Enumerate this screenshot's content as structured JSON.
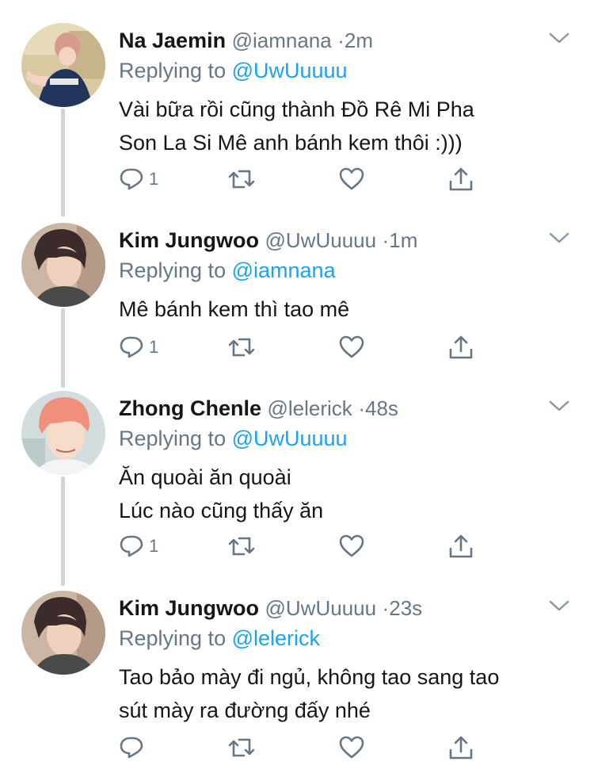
{
  "tweets": [
    {
      "name": "Na Jaemin",
      "handle": "@iamnana",
      "separator": "·",
      "time": "2m",
      "replying_prefix": "Replying to",
      "replying_to": "@UwUuuuu",
      "text": "Vài bữa rồi cũng thành Đồ Rê Mi Pha\nSon La Si Mê anh bánh kem thôi :)))",
      "reply_count": "1"
    },
    {
      "name": "Kim Jungwoo",
      "handle": "@UwUuuuu",
      "separator": "·",
      "time": "1m",
      "replying_prefix": "Replying to",
      "replying_to": "@iamnana",
      "text": "Mê bánh kem thì tao mê",
      "reply_count": "1"
    },
    {
      "name": "Zhong Chenle",
      "handle": "@lelerick",
      "separator": "·",
      "time": "48s",
      "replying_prefix": "Replying to",
      "replying_to": "@UwUuuuu",
      "text": "Ăn quoài ăn quoài\nLúc nào cũng thấy ăn",
      "reply_count": "1"
    },
    {
      "name": "Kim Jungwoo",
      "handle": "@UwUuuuu",
      "separator": "·",
      "time": "23s",
      "replying_prefix": "Replying to",
      "replying_to": "@lelerick",
      "text": "Tao bảo mày đi ngủ, không tao sang tao\nsút mày ra đường đấy nhé",
      "reply_count": ""
    }
  ],
  "icons": {
    "reply": "reply-icon",
    "retweet": "retweet-icon",
    "like": "heart-icon",
    "share": "share-icon",
    "more": "chevron-down-icon"
  },
  "colors": {
    "name": "#14171a",
    "meta": "#657786",
    "mention": "#1da1f2",
    "thread_line": "#ccd6dd"
  }
}
